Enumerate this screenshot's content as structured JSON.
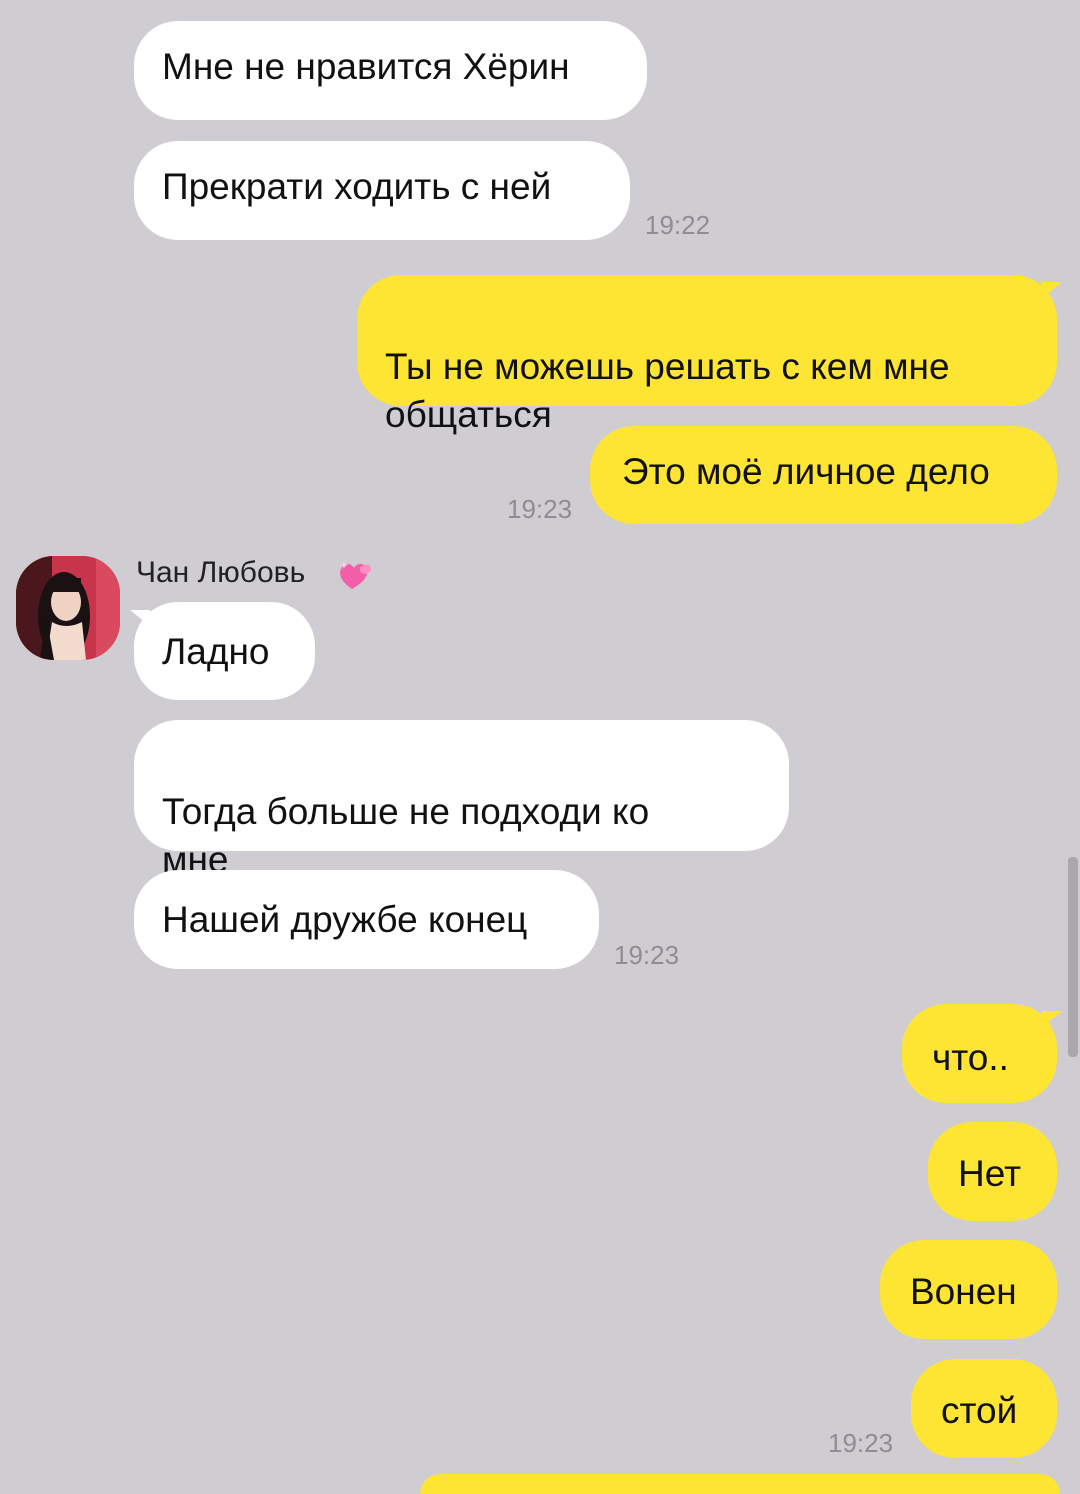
{
  "chat": {
    "contact_name": "Чан Любовь",
    "colors": {
      "background": "#cfcdd2",
      "incoming_bubble": "#ffffff",
      "outgoing_bubble": "#fee433",
      "timestamp": "#8f8d93"
    },
    "messages": [
      {
        "direction": "in",
        "text": "Мне не нравится Хёрин"
      },
      {
        "direction": "in",
        "text": "Прекрати ходить с ней",
        "time": "19:22"
      },
      {
        "direction": "out",
        "text": "Ты не можешь решать с кем мне\nобщаться"
      },
      {
        "direction": "out",
        "text": "Это моё личное дело",
        "time": "19:23"
      },
      {
        "direction": "in",
        "text": "Ладно"
      },
      {
        "direction": "in",
        "text": "Тогда больше не подходи ко\nмне"
      },
      {
        "direction": "in",
        "text": "Нашей дружбе конец",
        "time": "19:23"
      },
      {
        "direction": "out",
        "text": "что.."
      },
      {
        "direction": "out",
        "text": "Нет"
      },
      {
        "direction": "out",
        "text": "Вонен"
      },
      {
        "direction": "out",
        "text": "стой",
        "time": "19:23"
      }
    ]
  }
}
